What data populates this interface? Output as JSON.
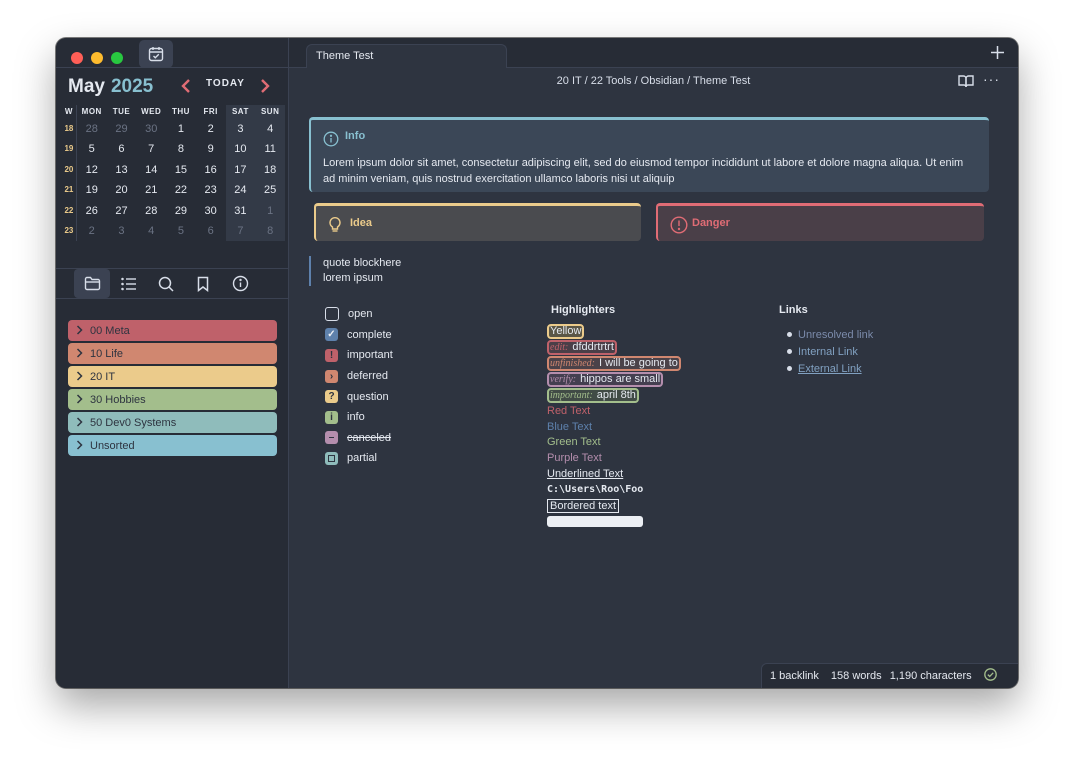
{
  "calendar": {
    "month": "May",
    "year": "2025",
    "today_label": "TODAY",
    "prev_arrow": "‹",
    "next_arrow": "›",
    "headers": [
      "W",
      "MON",
      "TUE",
      "WED",
      "THU",
      "FRI",
      "SAT",
      "SUN"
    ],
    "weeks": [
      {
        "wk": "18",
        "days": [
          "28",
          "29",
          "30",
          "1",
          "2",
          "3",
          "4"
        ]
      },
      {
        "wk": "19",
        "days": [
          "5",
          "6",
          "7",
          "8",
          "9",
          "10",
          "11"
        ]
      },
      {
        "wk": "20",
        "days": [
          "12",
          "13",
          "14",
          "15",
          "16",
          "17",
          "18"
        ]
      },
      {
        "wk": "21",
        "days": [
          "19",
          "20",
          "21",
          "22",
          "23",
          "24",
          "25"
        ]
      },
      {
        "wk": "22",
        "days": [
          "26",
          "27",
          "28",
          "29",
          "30",
          "31",
          "1"
        ]
      },
      {
        "wk": "23",
        "days": [
          "2",
          "3",
          "4",
          "5",
          "6",
          "7",
          "8"
        ]
      }
    ]
  },
  "sidebar": {
    "tabs": [
      "folder-icon",
      "list-icon",
      "search-icon",
      "bookmark-icon",
      "info-icon"
    ],
    "folders": [
      {
        "label": "00 Meta",
        "color": "#bf616a"
      },
      {
        "label": "10 Life",
        "color": "#d08770"
      },
      {
        "label": "20 IT",
        "color": "#ebcb8b"
      },
      {
        "label": "30 Hobbies",
        "color": "#a3be8c"
      },
      {
        "label": "50 Dev0 Systems",
        "color": "#8fbcbb"
      },
      {
        "label": "Unsorted",
        "color": "#88c0d0"
      }
    ]
  },
  "tabbar": {
    "active_tab": "Theme Test",
    "new_tab": "+"
  },
  "breadcrumb": "20 IT / 22 Tools / Obsidian / Theme Test",
  "header": {
    "more": "···"
  },
  "callouts": {
    "info": {
      "title": "Info",
      "body": "Lorem ipsum dolor sit amet, consectetur adipiscing elit, sed do eiusmod tempor incididunt ut labore et dolore magna aliqua. Ut enim ad minim veniam, quis nostrud exercitation ullamco laboris nisi ut aliquip"
    },
    "idea": {
      "title": "Idea"
    },
    "danger": {
      "title": "Danger"
    }
  },
  "quote": {
    "line1": "quote blockhere",
    "line2": "lorem ipsum"
  },
  "tasks": [
    {
      "label": "open",
      "mark": "",
      "color": "",
      "state": "open"
    },
    {
      "label": "complete",
      "mark": "✓",
      "color": "#5e81ac",
      "state": "complete"
    },
    {
      "label": "important",
      "mark": "!",
      "color": "#bf616a",
      "state": "important"
    },
    {
      "label": "deferred",
      "mark": "›",
      "color": "#d08770",
      "state": "deferred"
    },
    {
      "label": "question",
      "mark": "?",
      "color": "#ebcb8b",
      "state": "question"
    },
    {
      "label": "info",
      "mark": "i",
      "color": "#a3be8c",
      "state": "info"
    },
    {
      "label": "canceled",
      "mark": "–",
      "color": "#b48ead",
      "state": "canceled"
    },
    {
      "label": "partial",
      "mark": "□",
      "color": "#8fbcbb",
      "state": "partial"
    }
  ],
  "highlighters": {
    "title": "Highlighters",
    "yellow": "Yellow",
    "edit": {
      "tag": "edit:",
      "text": "dfddrtrtrt"
    },
    "unfinished": {
      "tag": "unfinished:",
      "text": "I will be going to"
    },
    "verify": {
      "tag": "verify:",
      "text": "hippos are small"
    },
    "important": {
      "tag": "important:",
      "text": "april 8th"
    },
    "red": "Red Text",
    "blue": "Blue Text",
    "green": "Green Text",
    "purple": "Purple Text",
    "underlined": "Underlined Text",
    "code": "C:\\Users\\Roo\\Foo",
    "bordered": "Bordered text"
  },
  "links": {
    "title": "Links",
    "items": [
      "Unresolved link",
      "Internal Link",
      "External Link"
    ]
  },
  "statusbar": {
    "backlinks": "1 backlink",
    "words": "158 words",
    "chars": "1,190 characters"
  }
}
